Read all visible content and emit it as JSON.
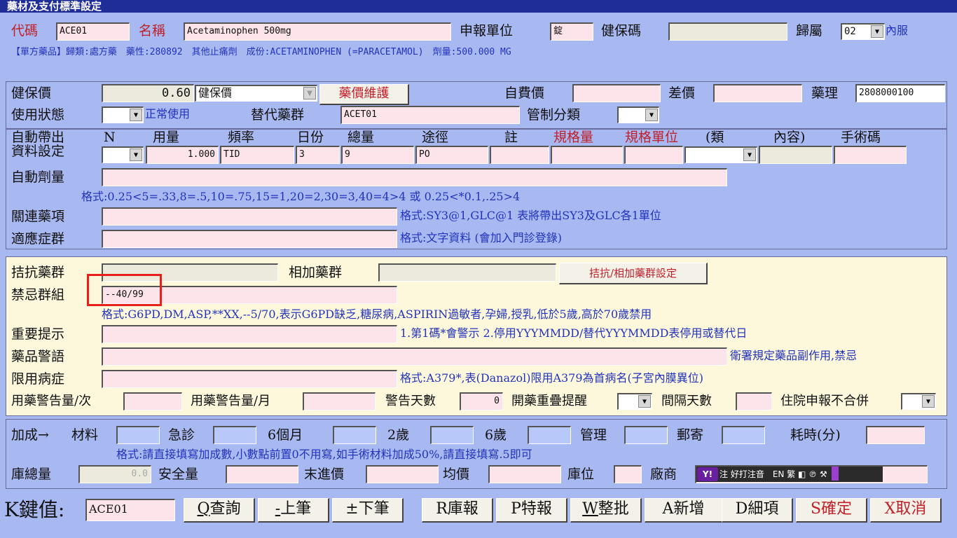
{
  "window_title": "藥材及支付標準設定",
  "header": {
    "code_label": "代碼",
    "code_value": "ACE01",
    "name_label": "名稱",
    "name_value": "Acetaminophen 500mg",
    "unit_label": "申報單位",
    "unit_value": "錠",
    "nhi_code_label": "健保碼",
    "nhi_code_value": "",
    "belong_label": "歸屬",
    "belong_value": "02",
    "belong_text": "內服",
    "info_line": "【單方藥品】歸類:處方藥　藥性:280892　其他止痛劑　成份:ACETAMINOPHEN (=PARACETAMOL)　劑量:500.000 MG"
  },
  "price": {
    "nhi_price_label": "健保價",
    "nhi_price_value": "0.60",
    "nhi_price_type": "健保價",
    "maintain_button": "藥價維護",
    "self_price_label": "自費價",
    "self_price_value": "",
    "diff_label": "差價",
    "diff_value": "",
    "pharm_label": "藥理",
    "pharm_value": "2808000100",
    "status_label": "使用狀態",
    "status_value": "",
    "status_text": "正常使用",
    "alt_group_label": "替代藥群",
    "alt_group_value": "ACET01",
    "control_label": "管制分類",
    "control_value": ""
  },
  "auto": {
    "row_label_1": "自動帶出",
    "row_label_2": "資料設定",
    "headers": [
      "N",
      "用量",
      "頻率",
      "日份",
      "總量",
      "途徑",
      "註",
      "規格量",
      "規格單位",
      "(類",
      "內容)",
      "手術碼"
    ],
    "values": {
      "n": "",
      "dose": "1.000",
      "freq": "TID",
      "days": "3",
      "total": "9",
      "route": "PO",
      "note": "",
      "spec_qty": "",
      "spec_unit": "",
      "type": "",
      "content": "",
      "surgery": ""
    },
    "auto_dose_label": "自動劑量",
    "auto_dose_value": "",
    "auto_dose_hint": "格式:0.25<5=.33,8=.5,10=.75,15=1,20=2,30=3,40=4>4 或 0.25<*0.1,.25>4",
    "related_label": "關連藥項",
    "related_value": "",
    "related_hint": "格式:SY3@1,GLC@1 表將帶出SY3及GLC各1單位",
    "indication_label": "適應症群",
    "indication_value": "",
    "indication_hint": "格式:文字資料 (會加入門診登錄)"
  },
  "yellow": {
    "antag_label": "拮抗藥群",
    "antag_value": "",
    "synergy_label": "相加藥群",
    "synergy_value": "",
    "antag_button": "拮抗/相加藥群設定",
    "contra_label": "禁忌群組",
    "contra_value": "--40/99",
    "contra_hint": "格式:G6PD,DM,ASP,**XX,--5/70,表示G6PD缺乏,糖尿病,ASPIRIN過敏者,孕婦,授乳,低於5歲,高於70歲禁用",
    "notice_label": "重要提示",
    "notice_value": "",
    "notice_hint": "1.第1碼*會警示 2.停用YYYMMDD/替代YYYMMDD表停用或替代日",
    "warning_label": "藥品警語",
    "warning_value": "",
    "warning_hint": "衛署規定藥品副作用,禁忌",
    "limit_label": "限用病症",
    "limit_value": "",
    "limit_hint": "格式:A379*,表(Danazol)限用A379為首病名(子宮內膜異位)",
    "warn_per_label": "用藥警告量/次",
    "warn_per_value": "",
    "warn_month_label": "用藥警告量/月",
    "warn_month_value": "",
    "warn_days_label": "警告天數",
    "warn_days_value": "0",
    "overlap_label": "開藥重疊提醒",
    "overlap_value": "",
    "interval_label": "間隔天數",
    "interval_value": "",
    "inpatient_label": "住院申報不合併",
    "inpatient_value": ""
  },
  "bottom": {
    "markup_label": "加成→",
    "material_label": "材料",
    "material_value": "",
    "emergency_label": "急診",
    "emergency_value": "",
    "six_month_label": "6個月",
    "six_month_value": "",
    "two_year_label": "2歲",
    "two_year_value": "",
    "six_year_label": "6歲",
    "six_year_value": "",
    "manage_label": "管理",
    "manage_value": "",
    "mail_label": "郵寄",
    "mail_value": "",
    "time_label": "耗時(分)",
    "time_value": "",
    "markup_hint": "格式:請直接填寫加成數,小數點前置0不用寫,如手術材料加成50%,請直接填寫.5即可",
    "stock_label": "庫總量",
    "stock_value": "0.0",
    "safety_label": "安全量",
    "safety_value": "",
    "last_price_label": "末進價",
    "last_price_value": "",
    "avg_price_label": "均價",
    "avg_price_value": "",
    "location_label": "庫位",
    "location_value": "",
    "vendor_label": "廠商",
    "vendor_value": "",
    "ime_text": "注 好打注音　EN 繁 ◧ ℗ ⚒"
  },
  "footer": {
    "key_label": "K鍵值:",
    "key_value": "ACE01",
    "buttons": [
      {
        "hot": "Q",
        "text": "查詢"
      },
      {
        "hot": "-",
        "text": "上筆"
      },
      {
        "hot": "±",
        "text": "下筆"
      },
      {
        "hot": "R",
        "text": "庫報"
      },
      {
        "hot": "P",
        "text": "特報"
      },
      {
        "hot": "W",
        "text": "整批"
      },
      {
        "hot": "A",
        "text": "新增"
      },
      {
        "hot": "D",
        "text": "細項"
      },
      {
        "hot": "S",
        "text": "確定"
      },
      {
        "hot": "X",
        "text": "取消"
      }
    ]
  },
  "colors": {
    "background": "#a8b8f0",
    "field": "#fce4ea",
    "yellow_panel": "#fdf8dc",
    "highlight": "#e8201c"
  }
}
